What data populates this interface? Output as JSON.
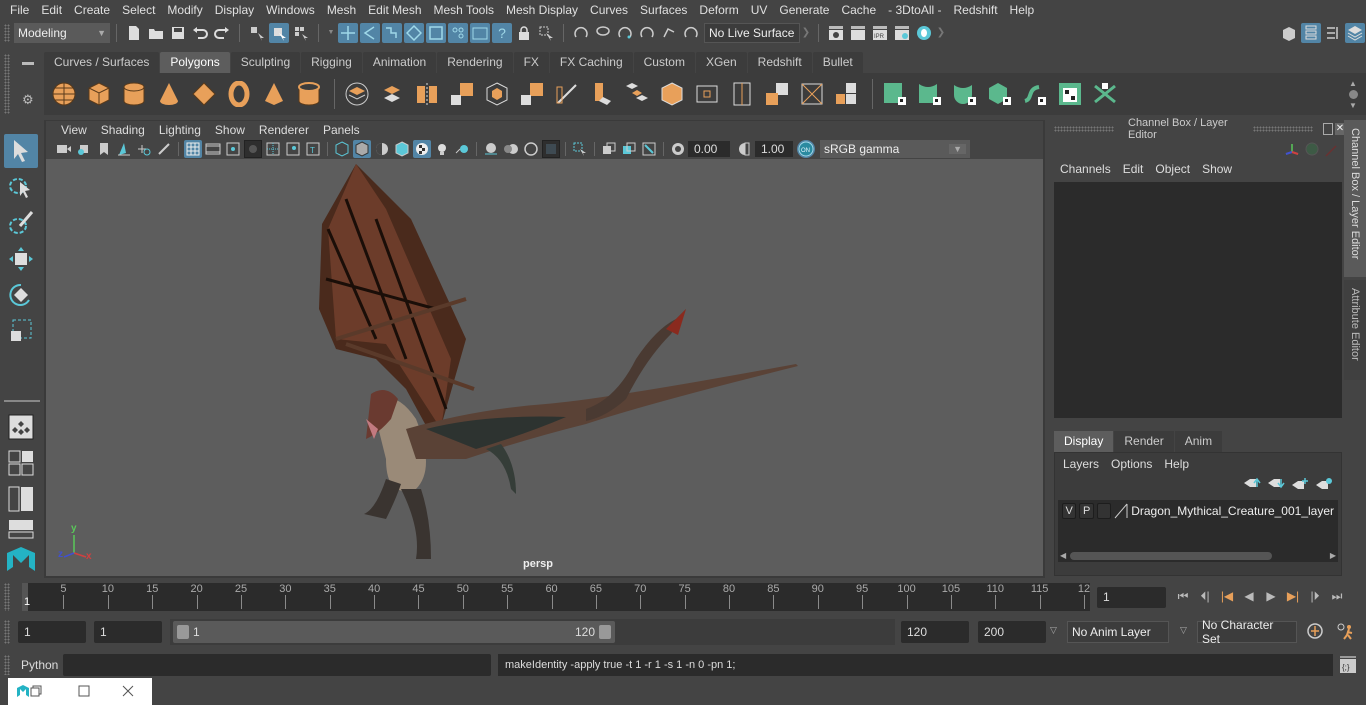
{
  "menubar": {
    "items": [
      "File",
      "Edit",
      "Create",
      "Select",
      "Modify",
      "Display",
      "Windows",
      "Mesh",
      "Edit Mesh",
      "Mesh Tools",
      "Mesh Display",
      "Curves",
      "Surfaces",
      "Deform",
      "UV",
      "Generate",
      "Cache",
      "- 3DtoAll -",
      "Redshift",
      "Help"
    ]
  },
  "statusline": {
    "workspace": "Modeling",
    "live_surface": "No Live Surface"
  },
  "shelf": {
    "tabs": [
      "Curves / Surfaces",
      "Polygons",
      "Sculpting",
      "Rigging",
      "Animation",
      "Rendering",
      "FX",
      "FX Caching",
      "Custom",
      "XGen",
      "Redshift",
      "Bullet"
    ],
    "active_tab": "Polygons"
  },
  "viewport": {
    "menu": [
      "View",
      "Shading",
      "Lighting",
      "Show",
      "Renderer",
      "Panels"
    ],
    "exposure": "0.00",
    "gamma": "1.00",
    "color_space": "sRGB gamma",
    "camera_label": "persp",
    "axis": {
      "x": "x",
      "y": "y",
      "z": "z"
    }
  },
  "channel_box": {
    "title": "Channel Box / Layer Editor",
    "menu": [
      "Channels",
      "Edit",
      "Object",
      "Show"
    ]
  },
  "side_tabs": [
    "Channel Box / Layer Editor",
    "Attribute Editor"
  ],
  "layer_editor": {
    "tabs": [
      "Display",
      "Render",
      "Anim"
    ],
    "active_tab": "Display",
    "menu": [
      "Layers",
      "Options",
      "Help"
    ],
    "layers": [
      {
        "v": "V",
        "p": "P",
        "name": "Dragon_Mythical_Creature_001_layer"
      }
    ]
  },
  "timeline": {
    "labels": [
      "5",
      "10",
      "15",
      "20",
      "25",
      "30",
      "35",
      "40",
      "45",
      "50",
      "55",
      "60",
      "65",
      "70",
      "75",
      "80",
      "85",
      "90",
      "95",
      "100",
      "105",
      "110",
      "115",
      "12"
    ],
    "current_frame_marker": "1",
    "current_frame": "1"
  },
  "range": {
    "start": "1",
    "playback_start": "1",
    "slider_min": "1",
    "slider_max": "120",
    "playback_end": "120",
    "end": "200",
    "anim_layer": "No Anim Layer",
    "character_set": "No Character Set"
  },
  "command_line": {
    "language": "Python",
    "input": "",
    "result": "makeIdentity -apply true -t 1 -r 1 -s 1 -n 0 -pn 1;"
  },
  "colors": {
    "accent": "#5285a6",
    "shelf_poly": "#e8a05a",
    "shelf_uv": "#5bb88d",
    "viewport_bg": "#5d5d5d"
  }
}
